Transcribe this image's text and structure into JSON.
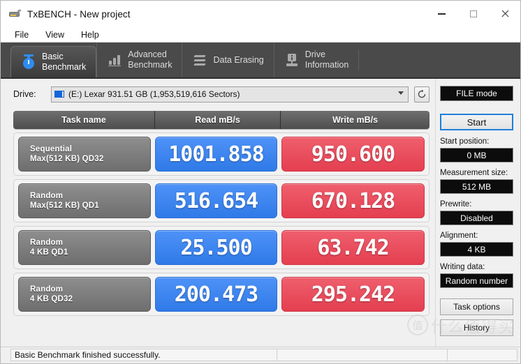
{
  "window": {
    "title": "TxBENCH - New project",
    "app_icon": "drive-device-icon",
    "minimize_label": "–",
    "maximize_label": "☐",
    "close_label": "✕"
  },
  "menu": {
    "items": [
      {
        "label": "File"
      },
      {
        "label": "View"
      },
      {
        "label": "Help"
      }
    ]
  },
  "tabs": [
    {
      "label": "Basic\nBenchmark",
      "icon": "stopwatch-icon",
      "active": true
    },
    {
      "label": "Advanced\nBenchmark",
      "icon": "bar-chart-icon",
      "active": false
    },
    {
      "label": "Data Erasing",
      "icon": "erase-waves-icon",
      "active": false
    },
    {
      "label": "Drive\nInformation",
      "icon": "drive-info-icon",
      "active": false
    }
  ],
  "drive": {
    "label": "Drive:",
    "icon": "disk-icon",
    "selected": "(E:) Lexar  931.51 GB (1,953,519,616 Sectors)",
    "caret_icon": "chevron-down-icon",
    "refresh_icon": "refresh-icon"
  },
  "results_table": {
    "headers": {
      "name": "Task name",
      "read": "Read mB/s",
      "write": "Write mB/s"
    },
    "rows": [
      {
        "line1": "Sequential",
        "line2": "Max(512 KB) QD32",
        "read": "1001.858",
        "write": "950.600"
      },
      {
        "line1": "Random",
        "line2": "Max(512 KB) QD1",
        "read": "516.654",
        "write": "670.128"
      },
      {
        "line1": "Random",
        "line2": "4 KB QD1",
        "read": "25.500",
        "write": "63.742"
      },
      {
        "line1": "Random",
        "line2": "4 KB QD32",
        "read": "200.473",
        "write": "295.242"
      }
    ]
  },
  "panel": {
    "mode_label": "FILE mode",
    "start_label": "Start",
    "fields": [
      {
        "label": "Start position:",
        "value": "0 MB"
      },
      {
        "label": "Measurement size:",
        "value": "512 MB"
      },
      {
        "label": "Prewrite:",
        "value": "Disabled"
      },
      {
        "label": "Alignment:",
        "value": "4 KB"
      },
      {
        "label": "Writing data:",
        "value": "Random number"
      }
    ],
    "task_options_label": "Task options",
    "history_label": "History"
  },
  "statusbar": {
    "message": "Basic Benchmark finished successfully."
  },
  "watermark": {
    "logo_char": "值",
    "text": "什么值得买"
  },
  "colors": {
    "read_chip": "#3b82f0",
    "write_chip": "#ec4b5a",
    "tab_bar": "#4a4a4a",
    "accent_start": "#1e7fdb"
  }
}
